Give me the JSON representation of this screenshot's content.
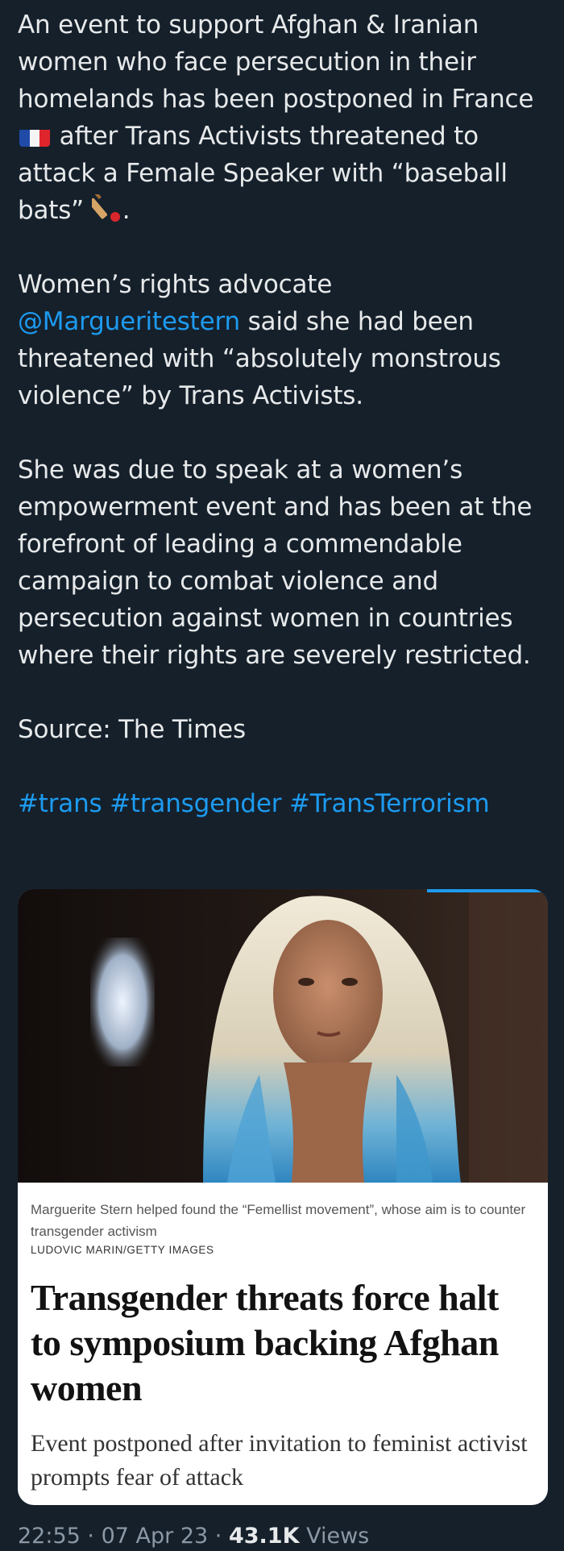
{
  "tweet": {
    "p1": {
      "a": "An event to support Afghan & Iranian women who face persecution in their homelands has been postponed in France",
      "b": "after Trans Activists threatened to attack a Female Speaker with “baseball bats”",
      "c": "."
    },
    "p2": {
      "a": "Women’s rights advocate",
      "mention": "@Margueritestern",
      "b": "said she had been threatened with “absolutely monstrous violence” by Trans Activists."
    },
    "p3": "She was due to speak at a women’s empowerment event and has been at the forefront of leading a commendable campaign to combat violence and persecution against women in countries where their rights are severely restricted.",
    "p4": "Source: The Times",
    "hashtags": [
      "#trans",
      "#transgender",
      "#TransTerrorism"
    ],
    "emoji": [
      "flag-france-icon",
      "cricket-bat-icon"
    ]
  },
  "card": {
    "caption": "Marguerite Stern helped found the “Femellist movement”, whose aim is to counter transgender activism",
    "credit": "LUDOVIC MARIN/GETTY IMAGES",
    "headline": "Transgender threats force halt to symposium backing Afghan women",
    "standfirst": "Event postponed after invitation to feminist activist prompts fear of attack"
  },
  "meta": {
    "time": "22:55",
    "sep1": "·",
    "date": "07 Apr 23",
    "sep2": "·",
    "views_count": "43.1K",
    "views_label": "Views"
  },
  "colors": {
    "background": "#15202b",
    "text": "#e7e9ea",
    "link": "#1d9bf0",
    "muted": "#8b98a5"
  }
}
